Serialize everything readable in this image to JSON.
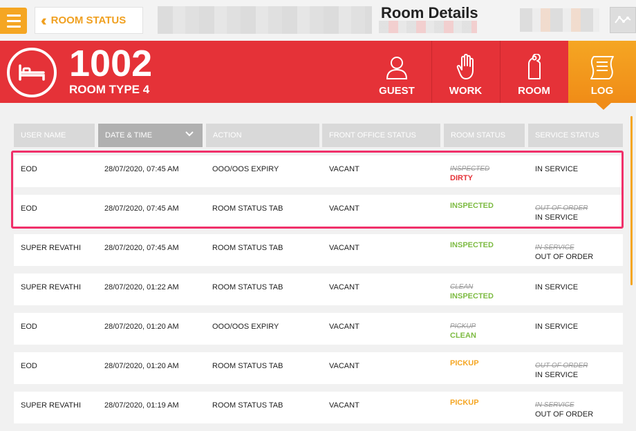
{
  "topbar": {
    "back_label": "ROOM STATUS",
    "page_title": "Room Details"
  },
  "room": {
    "number": "1002",
    "type": "ROOM TYPE 4"
  },
  "tabs": [
    {
      "label": "GUEST",
      "icon": "person-icon"
    },
    {
      "label": "WORK",
      "icon": "hand-icon"
    },
    {
      "label": "ROOM",
      "icon": "door-hanger-icon"
    },
    {
      "label": "LOG",
      "icon": "log-document-icon",
      "active": true
    }
  ],
  "table": {
    "headers": [
      "USER NAME",
      "DATE & TIME",
      "ACTION",
      "FRONT OFFICE STATUS",
      "ROOM STATUS",
      "SERVICE STATUS"
    ],
    "rows": [
      {
        "user": "EOD",
        "datetime": "28/07/2020, 07:45 AM",
        "action": "OOO/OOS EXPIRY",
        "front": "VACANT",
        "room_old": "INSPECTED",
        "room_new": "DIRTY",
        "service_old": "",
        "service_new": "IN SERVICE"
      },
      {
        "user": "EOD",
        "datetime": "28/07/2020, 07:45 AM",
        "action": "ROOM STATUS TAB",
        "front": "VACANT",
        "room_old": "",
        "room_new": "INSPECTED",
        "service_old": "OUT OF ORDER",
        "service_new": "IN SERVICE"
      },
      {
        "user": "SUPER REVATHI",
        "datetime": "28/07/2020, 07:45 AM",
        "action": "ROOM STATUS TAB",
        "front": "VACANT",
        "room_old": "",
        "room_new": "INSPECTED",
        "service_old": "IN SERVICE",
        "service_new": "OUT OF ORDER"
      },
      {
        "user": "SUPER REVATHI",
        "datetime": "28/07/2020, 01:22 AM",
        "action": "ROOM STATUS TAB",
        "front": "VACANT",
        "room_old": "CLEAN",
        "room_new": "INSPECTED",
        "service_old": "",
        "service_new": "IN SERVICE"
      },
      {
        "user": "EOD",
        "datetime": "28/07/2020, 01:20 AM",
        "action": "OOO/OOS EXPIRY",
        "front": "VACANT",
        "room_old": "PICKUP",
        "room_new": "CLEAN",
        "service_old": "",
        "service_new": "IN SERVICE"
      },
      {
        "user": "EOD",
        "datetime": "28/07/2020, 01:20 AM",
        "action": "ROOM STATUS TAB",
        "front": "VACANT",
        "room_old": "",
        "room_new": "PICKUP",
        "service_old": "OUT OF ORDER",
        "service_new": "IN SERVICE"
      },
      {
        "user": "SUPER REVATHI",
        "datetime": "28/07/2020, 01:19 AM",
        "action": "ROOM STATUS TAB",
        "front": "VACANT",
        "room_old": "",
        "room_new": "PICKUP",
        "service_old": "IN SERVICE",
        "service_new": "OUT OF ORDER"
      }
    ]
  },
  "colors": {
    "brand_red": "#e53238",
    "brand_orange": "#f5a623",
    "status_dirty": "#e53238",
    "status_inspected": "#7dbb42",
    "status_clean": "#7dbb42",
    "status_pickup": "#f5a623",
    "highlight": "#f0306a"
  }
}
